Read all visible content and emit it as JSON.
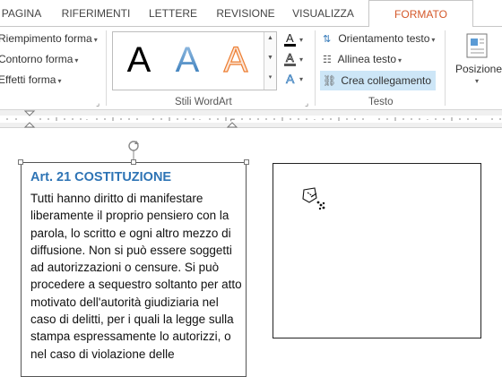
{
  "tabs": [
    {
      "label": "PAGINA"
    },
    {
      "label": "RIFERIMENTI"
    },
    {
      "label": "LETTERE"
    },
    {
      "label": "REVISIONE"
    },
    {
      "label": "VISUALIZZA"
    },
    {
      "label": "FORMATO"
    }
  ],
  "ribbon": {
    "shape_styles": {
      "fill": "Riempimento forma",
      "outline": "Contorno forma",
      "effects": "Effetti forma"
    },
    "wordart": {
      "group_label": "Stili WordArt",
      "gallery_letter": "A",
      "styles": [
        "#000000",
        "#5b9bd5",
        "#f4b183"
      ]
    },
    "text_group": {
      "direction": "Orientamento testo",
      "align": "Allinea testo",
      "link": "Crea collegamento",
      "group_label": "Testo"
    },
    "arrange": {
      "position": "Posizione"
    }
  },
  "document": {
    "textbox1": {
      "title": "Art. 21 COSTITUZIONE",
      "body": "Tutti hanno diritto di manifestare liberamente il proprio pensiero con la parola, lo scritto e ogni altro mezzo di diffusione. Non si può essere soggetti ad autorizzazioni o censure. Si può procedere a sequestro soltanto per atto motivato dell'autorità giudiziaria nel caso di delitti, per i quali la legge sulla stampa espressamente lo autorizzi, o nel caso di violazione delle"
    }
  },
  "colors": {
    "accent": "#d4582a",
    "title_blue": "#2e74b5",
    "link_highlight": "#cde6f7"
  }
}
